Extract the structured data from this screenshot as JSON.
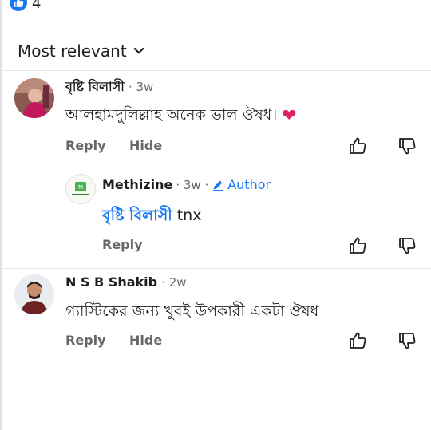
{
  "reactions": {
    "count": "4",
    "icon": "like-icon"
  },
  "sort": {
    "label": "Most relevant",
    "icon": "chevron-down-icon"
  },
  "comments": [
    {
      "author": "বৃষ্টি বিলাসী",
      "time": "· 3w",
      "text": "আলহামদুলিল্লাহ অনেক ভাল ঔষধ।",
      "emoji": "❤",
      "actions": {
        "reply": "Reply",
        "hide": "Hide"
      }
    },
    {
      "author": "Methizine",
      "time": "· 3w ·",
      "badge": "Author",
      "mention": "বৃষ্টি বিলাসী",
      "text": " tnx",
      "actions": {
        "reply": "Reply"
      }
    },
    {
      "author": "N S B Shakib",
      "time": "· 2w",
      "text": "গ্যাস্টিকের জন্য খুবই উপকারী একটা ঔষধ",
      "actions": {
        "reply": "Reply",
        "hide": "Hide"
      }
    }
  ],
  "colors": {
    "accent": "#1877f2",
    "muted": "#65676b",
    "heart": "#e0245e"
  }
}
